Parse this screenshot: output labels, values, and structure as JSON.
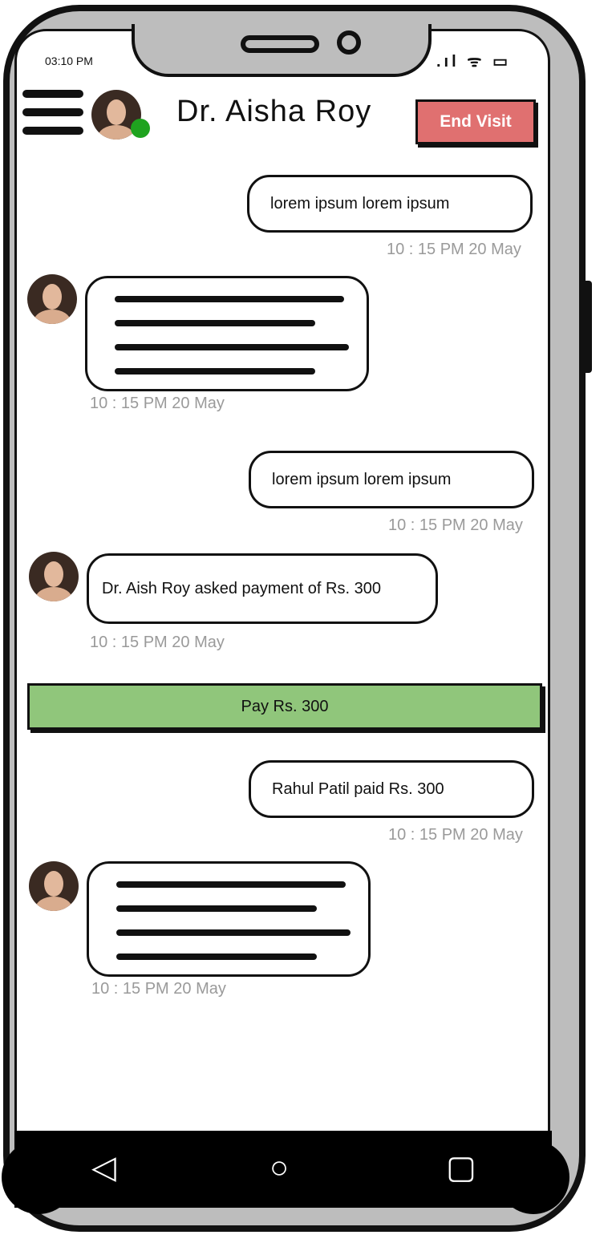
{
  "status_bar": {
    "time": "03:10 PM"
  },
  "header": {
    "title": "Dr. Aisha  Roy",
    "end_visit_label": "End Visit"
  },
  "messages": [
    {
      "text": "lorem ipsum lorem ipsum",
      "time": "10 : 15 PM 20 May"
    },
    {
      "text": "",
      "time": "10 : 15 PM 20 May"
    },
    {
      "text": "lorem ipsum lorem ipsum",
      "time": "10 : 15 PM 20 May"
    },
    {
      "text": "Dr. Aish Roy asked payment of Rs. 300",
      "time": "10 : 15 PM 20 May"
    },
    {
      "text": "Rahul Patil paid Rs. 300",
      "time": "10 : 15 PM 20 May"
    },
    {
      "text": "",
      "time": "10 : 15 PM 20 May"
    }
  ],
  "pay_button_label": "Pay Rs. 300",
  "icons": [
    "menu-icon",
    "signal-icon",
    "wifi-icon",
    "battery-icon",
    "back-icon",
    "home-icon",
    "recents-icon"
  ],
  "colors": {
    "end_visit": "#e07070",
    "pay_button": "#90c67b",
    "online": "#1fa31f"
  }
}
